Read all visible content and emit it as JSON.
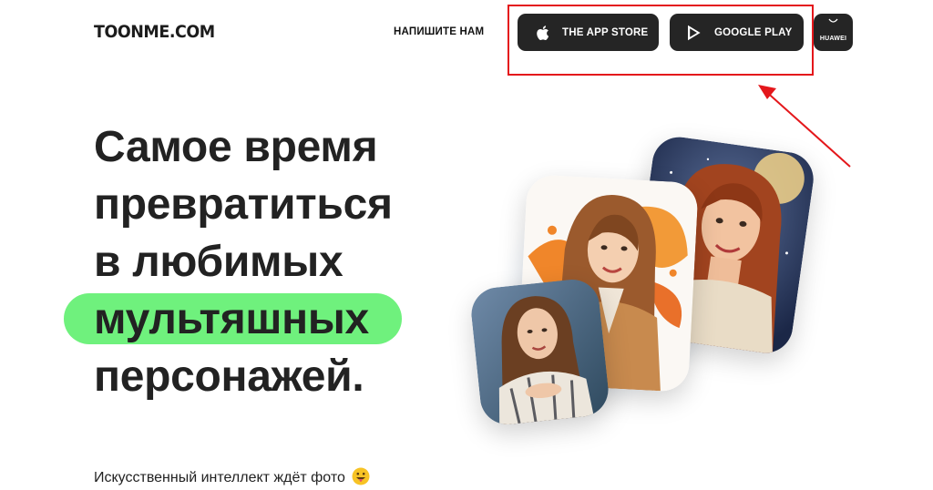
{
  "header": {
    "logo": "TOONME.COM",
    "contact_link": "НАПИШИТЕ НАМ",
    "buttons": {
      "appstore_label": "THE APP STORE",
      "google_label": "GOOGLE PLAY",
      "huawei_label": "HUAWEI"
    }
  },
  "hero": {
    "headline_lines": [
      "Самое время",
      "превратиться",
      "в любимых",
      "мультяшных",
      "персонажей."
    ],
    "subtitle": "Искусственный интеллект ждёт фото"
  },
  "colors": {
    "highlight_pill": "#6ff17d",
    "button_bg": "#252525",
    "annotation_red": "#e4171b"
  },
  "icons": [
    "apple-icon",
    "google-play-icon",
    "huawei-appgallery-icon",
    "tongue-emoji-icon"
  ]
}
